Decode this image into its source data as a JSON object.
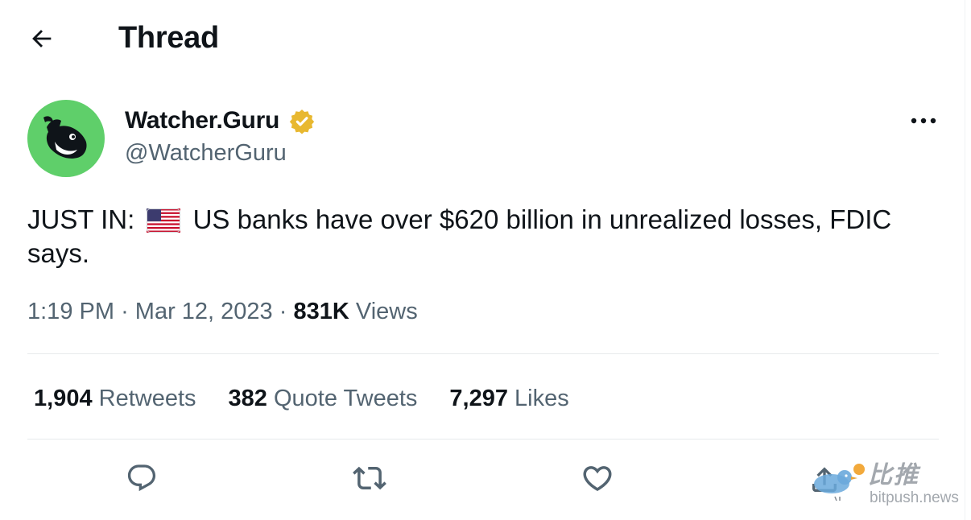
{
  "header": {
    "title": "Thread"
  },
  "author": {
    "display_name": "Watcher.Guru",
    "handle": "@WatcherGuru"
  },
  "tweet": {
    "text_prefix": "JUST IN: ",
    "text_body": " US banks have over $620 billion in unrealized losses, FDIC says."
  },
  "meta": {
    "time": "1:19 PM",
    "separator": "·",
    "date": "Mar 12, 2023",
    "views_count": "831K",
    "views_label": "Views"
  },
  "stats": [
    {
      "count": "1,904",
      "label": "Retweets"
    },
    {
      "count": "382",
      "label": "Quote Tweets"
    },
    {
      "count": "7,297",
      "label": "Likes"
    }
  ],
  "actions": [
    "reply-icon",
    "retweet-icon",
    "like-icon",
    "share-icon"
  ],
  "watermark": {
    "brand": "比推",
    "url": "bitpush.news"
  },
  "colors": {
    "text": "#0f1419",
    "secondary": "#536471",
    "avatar_bg": "#5fcf6a",
    "badge": "#e8b830"
  }
}
